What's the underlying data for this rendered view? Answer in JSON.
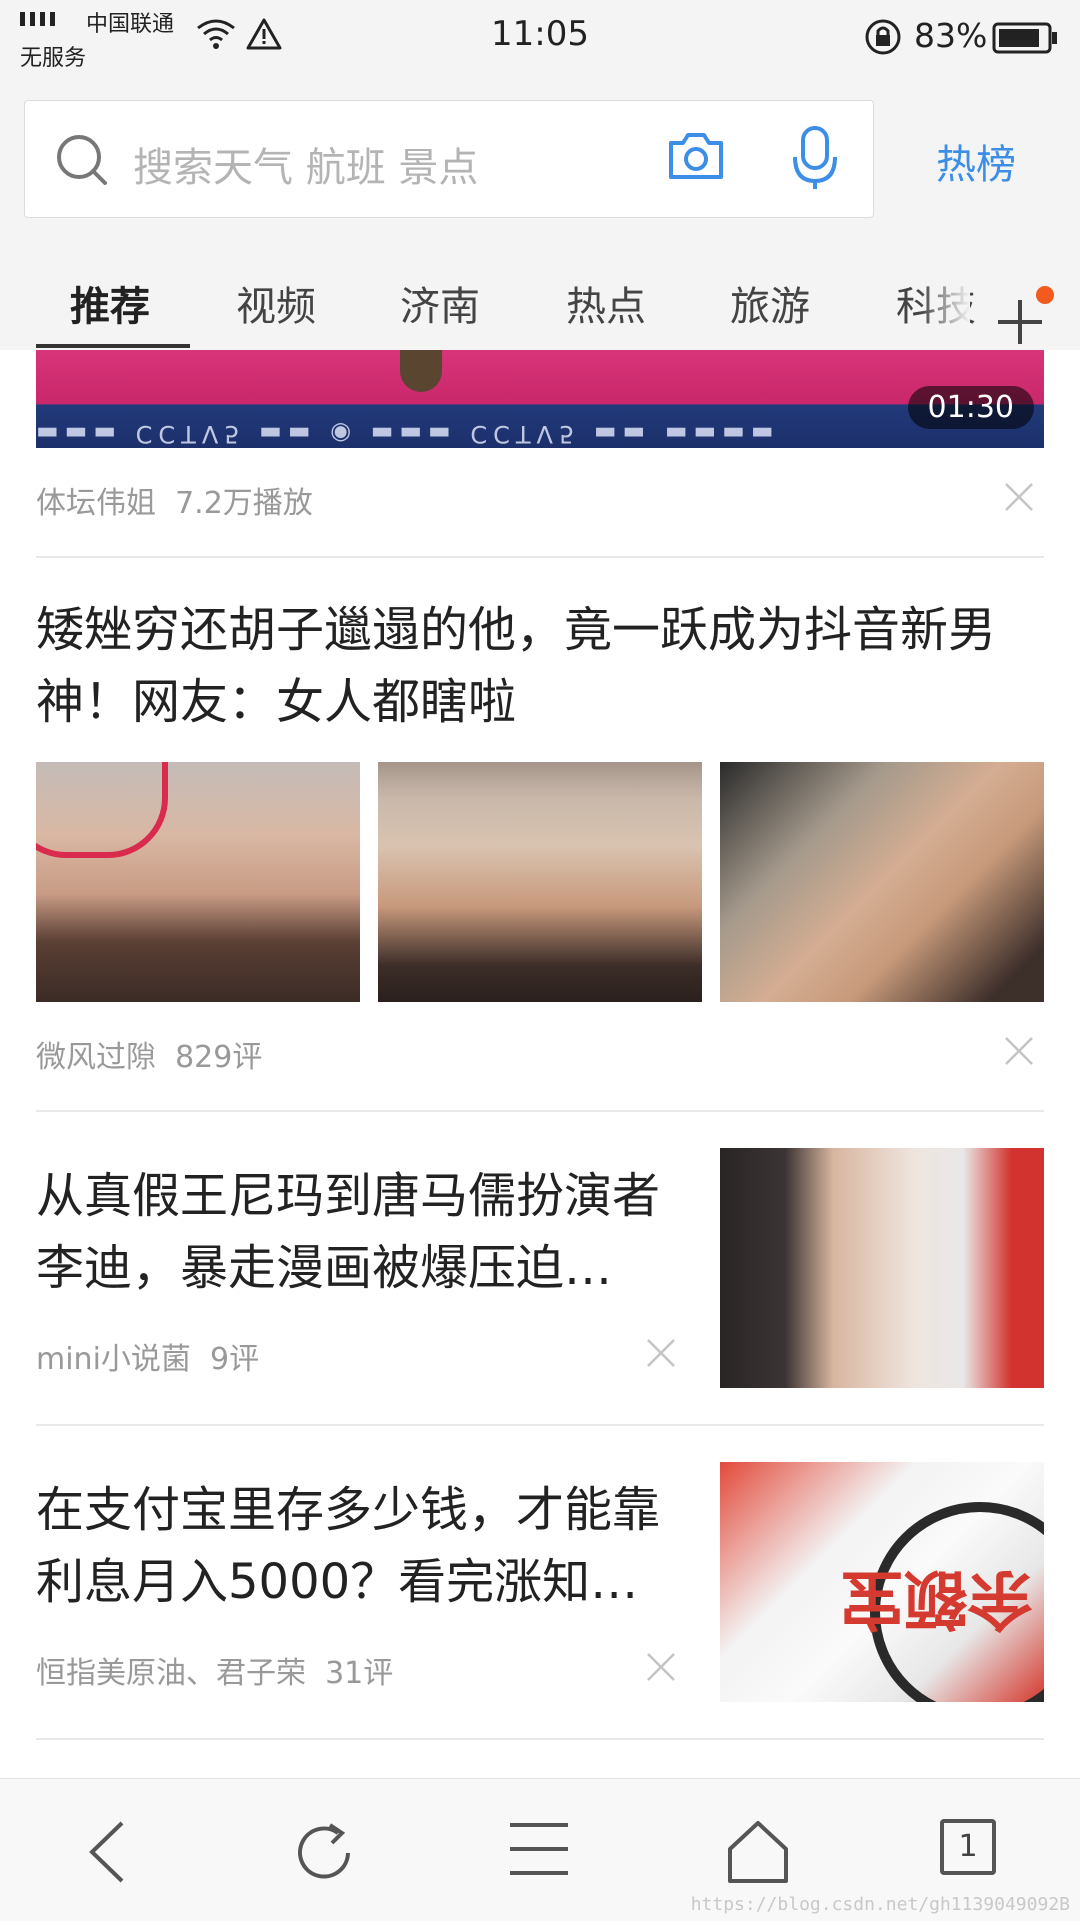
{
  "status_bar": {
    "carrier": "中国联通",
    "service": "无服务",
    "time": "11:05",
    "battery": "83%"
  },
  "search": {
    "placeholder": "搜索天气 航班 景点",
    "hot_label": "热榜"
  },
  "tabs": [
    "推荐",
    "视频",
    "济南",
    "热点",
    "旅游",
    "科技"
  ],
  "feed": {
    "video": {
      "duration": "01:30",
      "source": "体坛伟姐",
      "stats": "7.2万播放"
    },
    "article1": {
      "title": "矮矬穷还胡子邋遢的他，竟一跃成为抖音新男神！网友：女人都瞎啦",
      "source": "微风过隙",
      "stats": "829评"
    },
    "article2": {
      "title": "从真假王尼玛到唐马儒扮演者李迪，暴走漫画被爆压迫…",
      "source": "mini小说菌",
      "stats": "9评"
    },
    "article3": {
      "title": "在支付宝里存多少钱，才能靠利息月入5000？看完涨知…",
      "source": "恒指美原油、君子荣",
      "stats": "31评",
      "thumb_text": "余额宝"
    }
  },
  "bottom_nav": {
    "tab_count": "1"
  },
  "watermark": "https://blog.csdn.net/gh1139049092B",
  "colors": {
    "accent": "#3d8ee6",
    "notify_dot": "#f25a1e",
    "header_bg": "#f4f4f4"
  }
}
